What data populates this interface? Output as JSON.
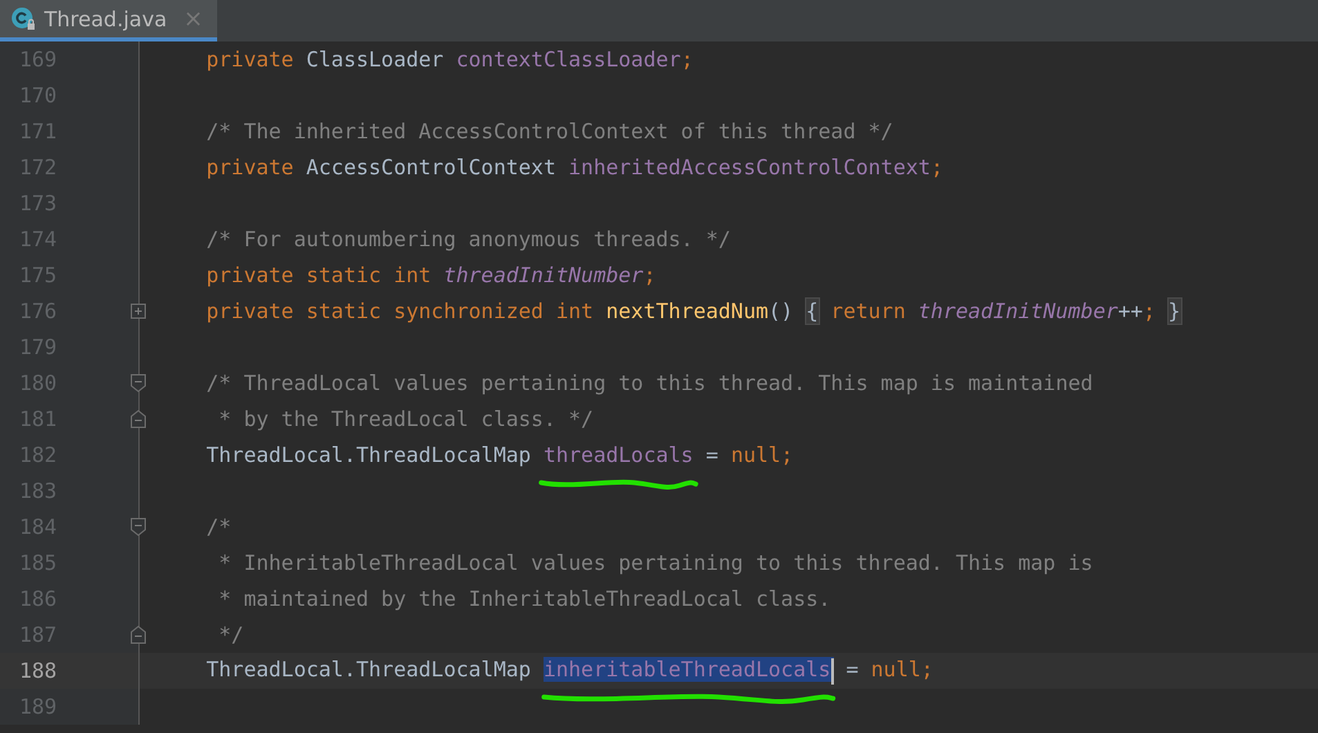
{
  "tabs": [
    {
      "label": "Thread.java",
      "selected": true,
      "close": "×"
    }
  ],
  "lines": [
    {
      "number": "169",
      "tokens": [
        {
          "kind": "kw",
          "text": "    private "
        },
        {
          "kind": "type",
          "text": "ClassLoader "
        },
        {
          "kind": "field",
          "text": "contextClassLoader"
        },
        {
          "kind": "kw",
          "text": ";"
        }
      ]
    },
    {
      "number": "170"
    },
    {
      "number": "171",
      "tokens": [
        {
          "kind": "comment",
          "text": "    /* The inherited AccessControlContext of this thread */"
        }
      ]
    },
    {
      "number": "172",
      "tokens": [
        {
          "kind": "kw",
          "text": "    private "
        },
        {
          "kind": "type",
          "text": "AccessControlContext "
        },
        {
          "kind": "field",
          "text": "inheritedAccessControlContext"
        },
        {
          "kind": "kw",
          "text": ";"
        }
      ]
    },
    {
      "number": "173"
    },
    {
      "number": "174",
      "tokens": [
        {
          "kind": "comment",
          "text": "    /* For autonumbering anonymous threads. */"
        }
      ]
    },
    {
      "number": "175",
      "tokens": [
        {
          "kind": "kw",
          "text": "    private static int "
        },
        {
          "kind": "static",
          "text": "threadInitNumber"
        },
        {
          "kind": "kw",
          "text": ";"
        }
      ]
    },
    {
      "number": "176",
      "fold_marker": {
        "kind": "expand"
      },
      "tokens": [
        {
          "kind": "kw",
          "text": "    private static synchronized int "
        },
        {
          "kind": "method",
          "text": "nextThreadNum"
        },
        {
          "kind": "type",
          "text": "() "
        },
        {
          "kind": "folded",
          "text": "{"
        },
        {
          "kind": "kw",
          "text": " return "
        },
        {
          "kind": "static",
          "text": "threadInitNumber"
        },
        {
          "kind": "type",
          "text": "++"
        },
        {
          "kind": "kw",
          "text": "; "
        },
        {
          "kind": "folded",
          "text": "}"
        }
      ]
    },
    {
      "number": "179"
    },
    {
      "number": "180",
      "fold_marker": {
        "kind": "start"
      },
      "tokens": [
        {
          "kind": "comment",
          "text": "    /* ThreadLocal values pertaining to this thread. This map is maintained"
        }
      ]
    },
    {
      "number": "181",
      "fold_marker": {
        "kind": "end"
      },
      "tokens": [
        {
          "kind": "comment",
          "text": "     * by the ThreadLocal class. */"
        }
      ]
    },
    {
      "number": "182",
      "tokens": [
        {
          "kind": "type",
          "text": "    ThreadLocal.ThreadLocalMap "
        },
        {
          "kind": "field",
          "text": "threadLocals",
          "underlined": true
        },
        {
          "kind": "type",
          "text": " = "
        },
        {
          "kind": "kw",
          "text": "null;"
        }
      ]
    },
    {
      "number": "183"
    },
    {
      "number": "184",
      "fold_marker": {
        "kind": "start"
      },
      "tokens": [
        {
          "kind": "comment",
          "text": "    /*"
        }
      ]
    },
    {
      "number": "185",
      "tokens": [
        {
          "kind": "comment",
          "text": "     * InheritableThreadLocal values pertaining to this thread. This map is"
        }
      ]
    },
    {
      "number": "186",
      "tokens": [
        {
          "kind": "comment",
          "text": "     * maintained by the InheritableThreadLocal class."
        }
      ]
    },
    {
      "number": "187",
      "fold_marker": {
        "kind": "end"
      },
      "tokens": [
        {
          "kind": "comment",
          "text": "     */"
        }
      ]
    },
    {
      "number": "188",
      "current": true,
      "tokens": [
        {
          "kind": "type",
          "text": "    ThreadLocal.ThreadLocalMap "
        },
        {
          "kind": "field",
          "text": "inheritableThreadLocals",
          "selected": true,
          "underlined": true,
          "caret": true
        },
        {
          "kind": "type",
          "text": " = "
        },
        {
          "kind": "kw",
          "text": "null;"
        }
      ]
    },
    {
      "number": "189"
    }
  ]
}
